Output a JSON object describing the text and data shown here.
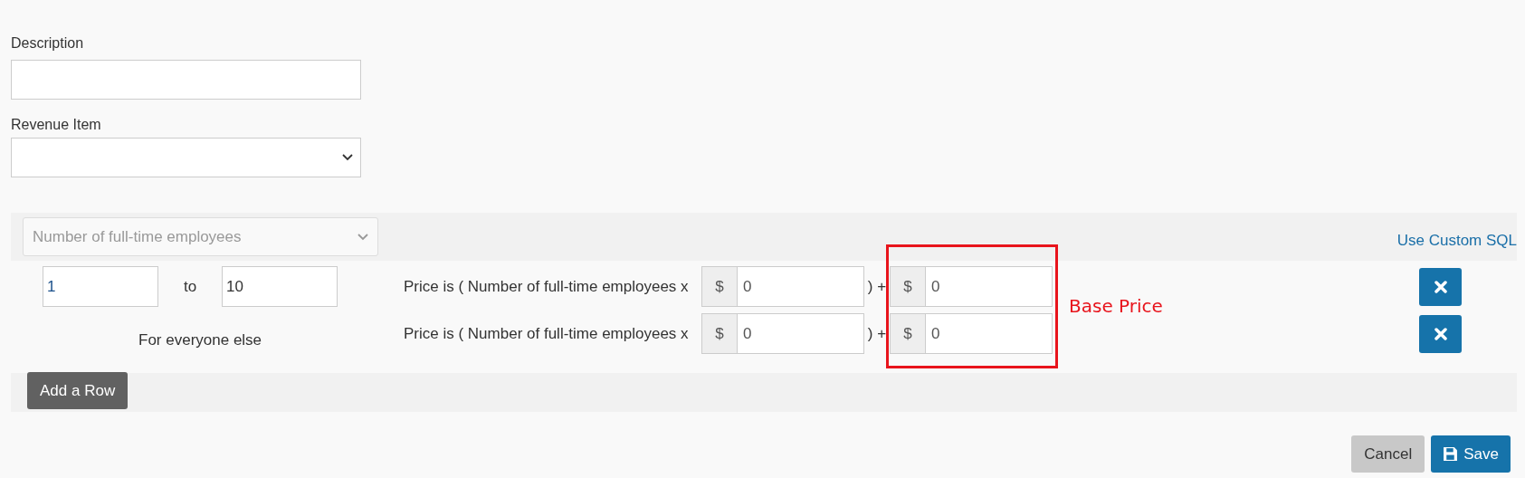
{
  "form": {
    "description": {
      "label": "Description"
    },
    "revenue_item": {
      "label": "Revenue Item"
    }
  },
  "tier_table": {
    "basis_select": {
      "placeholder": "Number of full-time employees"
    },
    "custom_sql_link": "Use Custom SQL",
    "rows": [
      {
        "kind": "range",
        "from": "1",
        "separator": "to",
        "to": "10",
        "price_text": "Price is ( Number of full-time employees x",
        "unit_currency": "$",
        "unit_price": "0",
        "plus": ") +",
        "base_currency": "$",
        "base_price": "0"
      },
      {
        "kind": "else",
        "label": "For everyone else",
        "price_text": "Price is ( Number of full-time employees x",
        "unit_currency": "$",
        "unit_price": "0",
        "plus": ") +",
        "base_currency": "$",
        "base_price": "0"
      }
    ],
    "annotation": "Base Price",
    "add_row_button": "Add a Row"
  },
  "buttons": {
    "cancel": "Cancel",
    "save": "Save"
  }
}
